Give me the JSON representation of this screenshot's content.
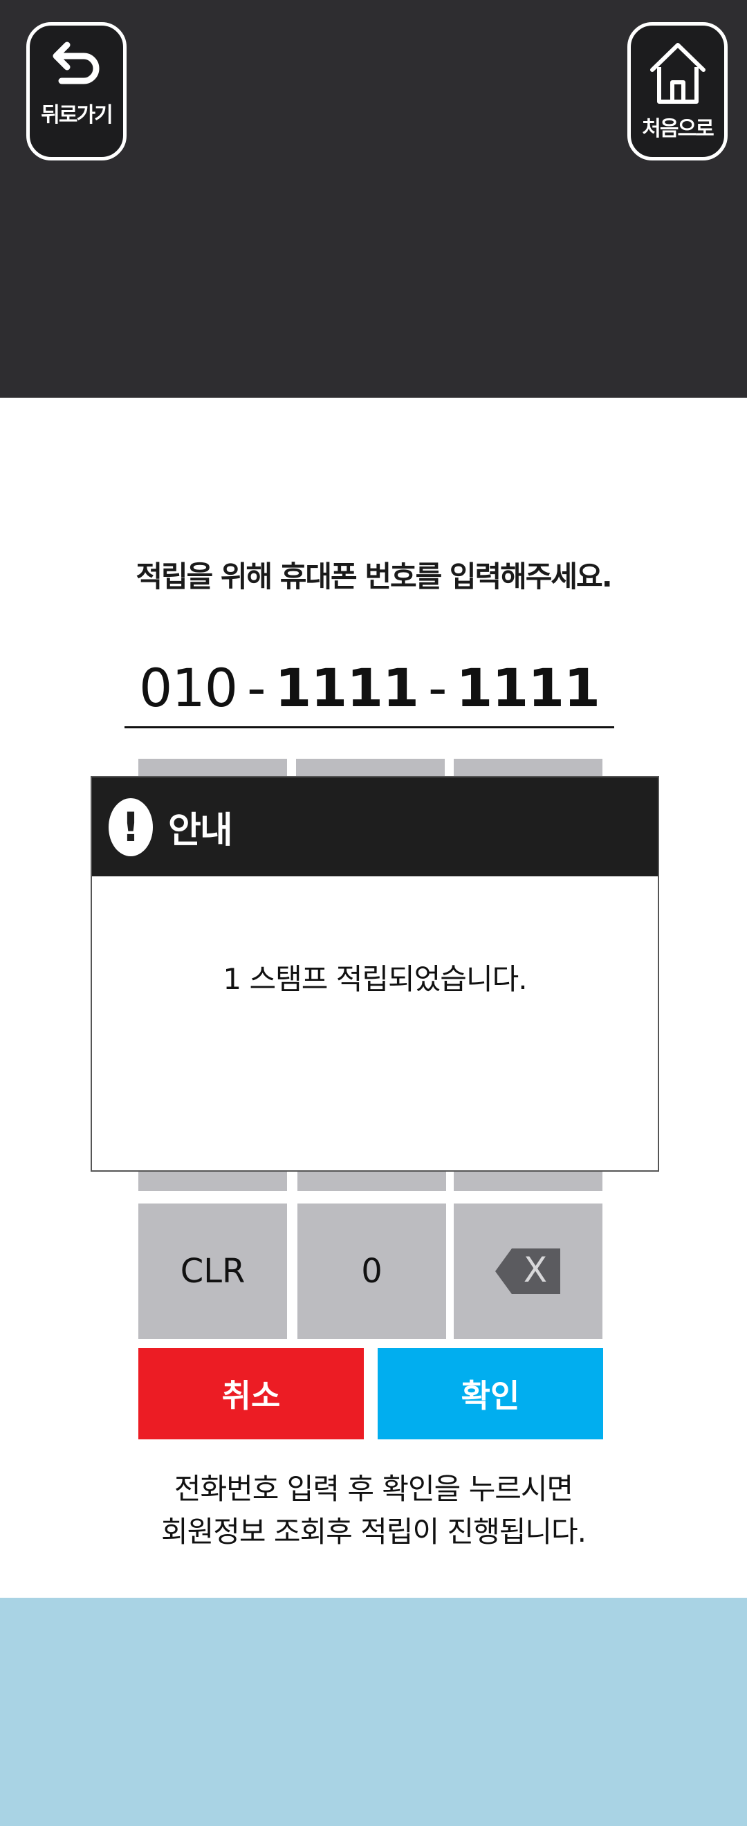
{
  "nav": {
    "back_label": "뒤로가기",
    "home_label": "처음으로"
  },
  "prompt": "적립을 위해 휴대폰 번호를 입력해주세요.",
  "phone": {
    "part1": "010",
    "dash1": "-",
    "part2": "1111",
    "dash2": "-",
    "part3": "1111"
  },
  "keypad": {
    "clear_label": "CLR",
    "zero_label": "0",
    "backspace_glyph": "X"
  },
  "actions": {
    "cancel_label": "취소",
    "ok_label": "확인"
  },
  "hint": {
    "line1": "전화번호 입력 후 확인을 누르시면",
    "line2": "회원정보 조회후 적립이 진행됩니다."
  },
  "modal": {
    "icon": "!",
    "title": "안내",
    "message": "1 스탬프 적립되었습니다."
  },
  "colors": {
    "topbar": "#2e2d30",
    "cancel": "#ec1c24",
    "ok": "#01aeef",
    "key": "#bcbcc0",
    "bottom": "#a9d3e4"
  }
}
